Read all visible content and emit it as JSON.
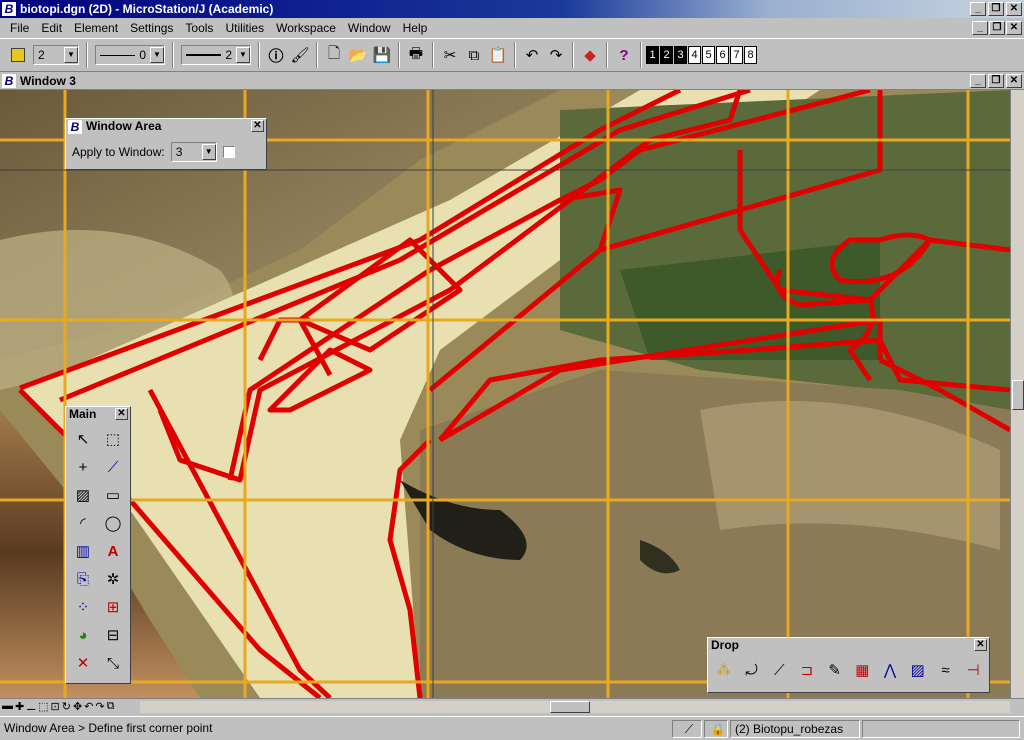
{
  "app": {
    "title": "biotopi.dgn (2D) - MicroStation/J (Academic)",
    "logo_letter": "B"
  },
  "menu": [
    "File",
    "Edit",
    "Element",
    "Settings",
    "Tools",
    "Utilities",
    "Workspace",
    "Window",
    "Help"
  ],
  "toolbar": {
    "active_color": "#e8c820",
    "level_value": "2",
    "style_value": "0",
    "weight_value": "2",
    "view_buttons": [
      "1",
      "2",
      "3",
      "4",
      "5",
      "6",
      "7",
      "8"
    ]
  },
  "view_window": {
    "title": "Window 3"
  },
  "window_area": {
    "title": "Window Area",
    "apply_label": "Apply to Window:",
    "apply_value": "3"
  },
  "main_palette": {
    "title": "Main"
  },
  "drop_palette": {
    "title": "Drop"
  },
  "status": {
    "prompt": "Window Area > Define first corner point",
    "level_name": "(2) Biotopu_robezas"
  }
}
